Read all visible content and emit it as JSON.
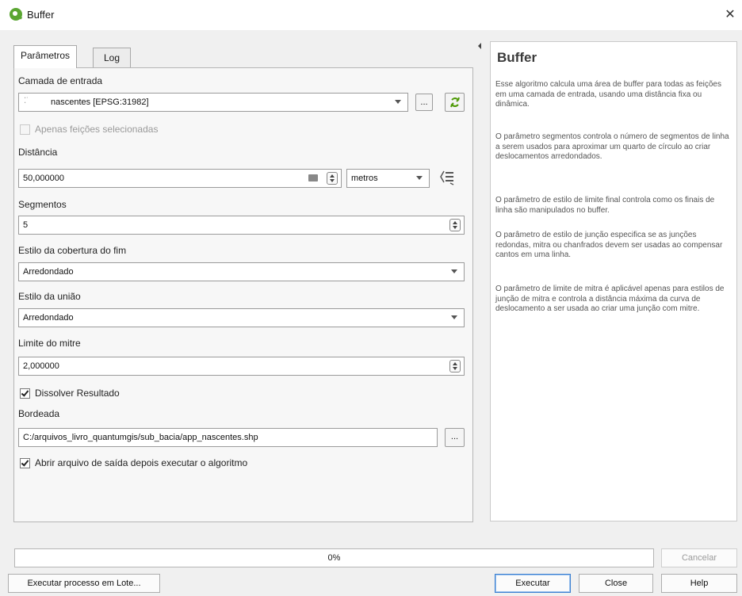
{
  "window": {
    "title": "Buffer"
  },
  "tabs": [
    "Parâmetros",
    "Log"
  ],
  "params": {
    "input_layer_label": "Camada de entrada",
    "input_layer_value": "nascentes [EPSG:31982]",
    "selected_only_label": "Apenas feições selecionadas",
    "distance_label": "Distância",
    "distance_value": "50,000000",
    "distance_unit": "metros",
    "segments_label": "Segmentos",
    "segments_value": "5",
    "end_cap_label": "Estilo da cobertura do fim",
    "end_cap_value": "Arredondado",
    "join_label": "Estilo da união",
    "join_value": "Arredondado",
    "miter_label": "Limite do mitre",
    "miter_value": "2,000000",
    "dissolve_label": "Dissolver Resultado",
    "dissolve_checked": true,
    "output_label": "Bordeada",
    "output_value": "C:/arquivos_livro_quantumgis/sub_bacia/app_nascentes.shp",
    "open_output_label": "Abrir arquivo de saída depois executar o algoritmo",
    "open_output_checked": true,
    "browse_label": "..."
  },
  "help": {
    "title": "Buffer",
    "paragraphs": [
      "Esse algoritmo calcula uma área de buffer para todas as feições em uma camada de entrada, usando uma distância fixa ou dinâmica.",
      "O parâmetro segmentos controla o número de segmentos de linha a serem usados para aproximar um quarto de círculo ao criar deslocamentos arredondados.",
      "O parâmetro de estilo de limite final controla como os finais de linha são manipulados no buffer.",
      "O parâmetro de estilo de junção especifica se as junções redondas, mitra ou chanfrados devem ser usadas ao compensar cantos em uma linha.",
      "O parâmetro de limite de mitra é aplicável apenas para estilos de junção de mitra e controla a distância máxima da curva de deslocamento a ser usada ao criar uma junção com mitre."
    ]
  },
  "progress": {
    "value": 0,
    "text": "0%"
  },
  "buttons": {
    "cancel": "Cancelar",
    "batch": "Executar processo em Lote...",
    "run": "Executar",
    "close": "Close",
    "help": "Help"
  },
  "colors": {
    "accent": "#3b7fd1",
    "logo": "#5aa632"
  }
}
